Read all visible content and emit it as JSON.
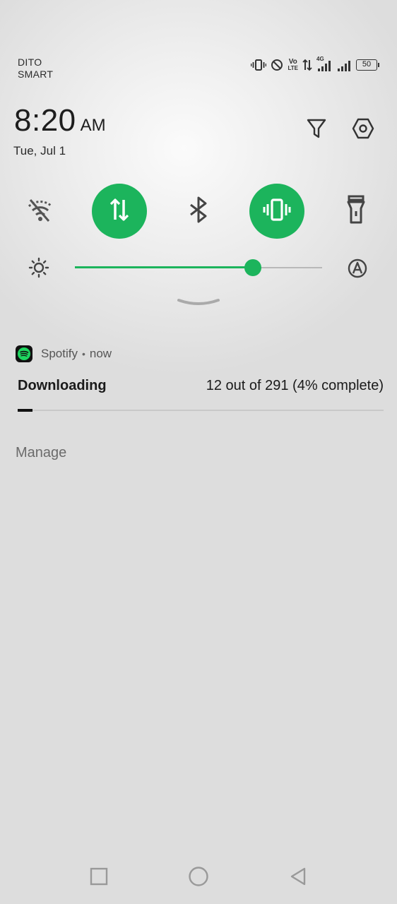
{
  "status_bar": {
    "carrier_line1": "DITO",
    "carrier_line2": "SMART",
    "icons": [
      "vibrate-icon",
      "do-not-disturb-icon",
      "volte-icon",
      "data-arrows-icon",
      "signal-4g-icon",
      "signal-icon"
    ],
    "volte_top": "Vo",
    "volte_bottom": "LTE",
    "network_type": "4G",
    "battery": "50"
  },
  "header": {
    "time": "8:20",
    "ampm": "AM",
    "date": "Tue, Jul 1",
    "icons": [
      "filter-icon",
      "settings-icon"
    ]
  },
  "quick_settings": {
    "accent_color": "#1cb45c",
    "tiles": [
      {
        "name": "wifi",
        "icon": "wifi-off-icon",
        "active": false
      },
      {
        "name": "mobile-data",
        "icon": "data-arrows-icon",
        "active": true
      },
      {
        "name": "bluetooth",
        "icon": "bluetooth-icon",
        "active": false
      },
      {
        "name": "vibrate",
        "icon": "vibrate-icon",
        "active": true
      },
      {
        "name": "flashlight",
        "icon": "flashlight-icon",
        "active": false
      }
    ],
    "brightness": {
      "level_percent": 72,
      "icons": [
        "brightness-icon",
        "auto-brightness-icon"
      ]
    }
  },
  "notification": {
    "app": "Spotify",
    "separator": "•",
    "time": "now",
    "title": "Downloading",
    "progress_text": "12 out of 291 (4% complete)",
    "progress_fraction": 0.04,
    "manage_label": "Manage"
  },
  "navigation": {
    "buttons": [
      "recents-button",
      "home-button",
      "back-button"
    ]
  }
}
